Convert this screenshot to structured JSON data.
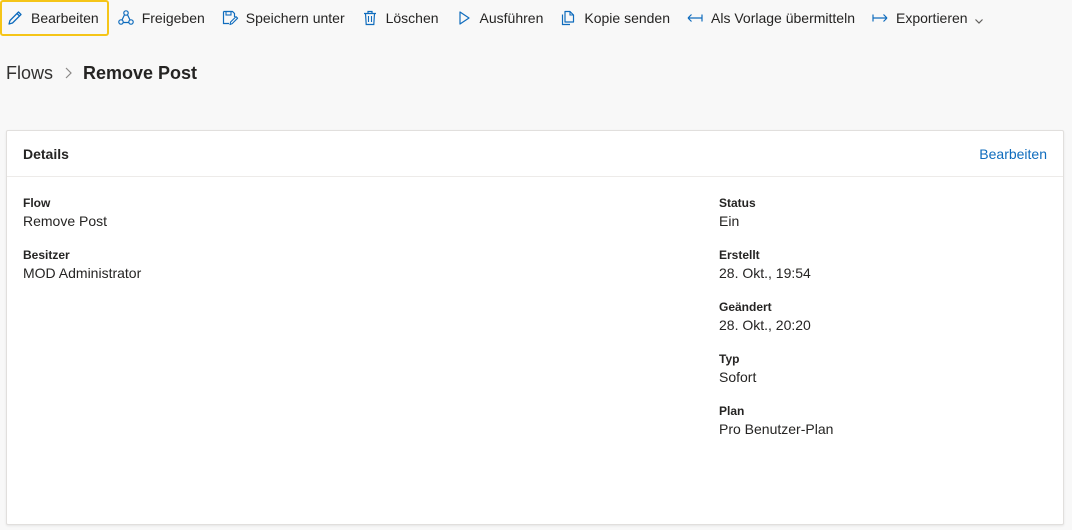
{
  "toolbar": {
    "items": [
      {
        "label": "Bearbeiten",
        "icon": "pencil-icon"
      },
      {
        "label": "Freigeben",
        "icon": "share-icon"
      },
      {
        "label": "Speichern unter",
        "icon": "save-as-icon"
      },
      {
        "label": "Löschen",
        "icon": "trash-icon"
      },
      {
        "label": "Ausführen",
        "icon": "play-icon"
      },
      {
        "label": "Kopie senden",
        "icon": "copy-icon"
      },
      {
        "label": "Als Vorlage übermitteln",
        "icon": "submit-arrow-icon"
      },
      {
        "label": "Exportieren",
        "icon": "export-arrow-icon"
      }
    ]
  },
  "breadcrumb": {
    "root": "Flows",
    "current": "Remove Post"
  },
  "details": {
    "title": "Details",
    "edit_label": "Bearbeiten",
    "left": [
      {
        "label": "Flow",
        "value": "Remove Post"
      },
      {
        "label": "Besitzer",
        "value": "MOD Administrator"
      }
    ],
    "right": [
      {
        "label": "Status",
        "value": "Ein"
      },
      {
        "label": "Erstellt",
        "value": "28. Okt., 19:54"
      },
      {
        "label": "Geändert",
        "value": "28. Okt., 20:20"
      },
      {
        "label": "Typ",
        "value": "Sofort"
      },
      {
        "label": "Plan",
        "value": "Pro Benutzer-Plan"
      }
    ]
  },
  "colors": {
    "accent": "#0f6cbd",
    "focus_outline": "#f5c518",
    "background": "#f8f8f8"
  }
}
